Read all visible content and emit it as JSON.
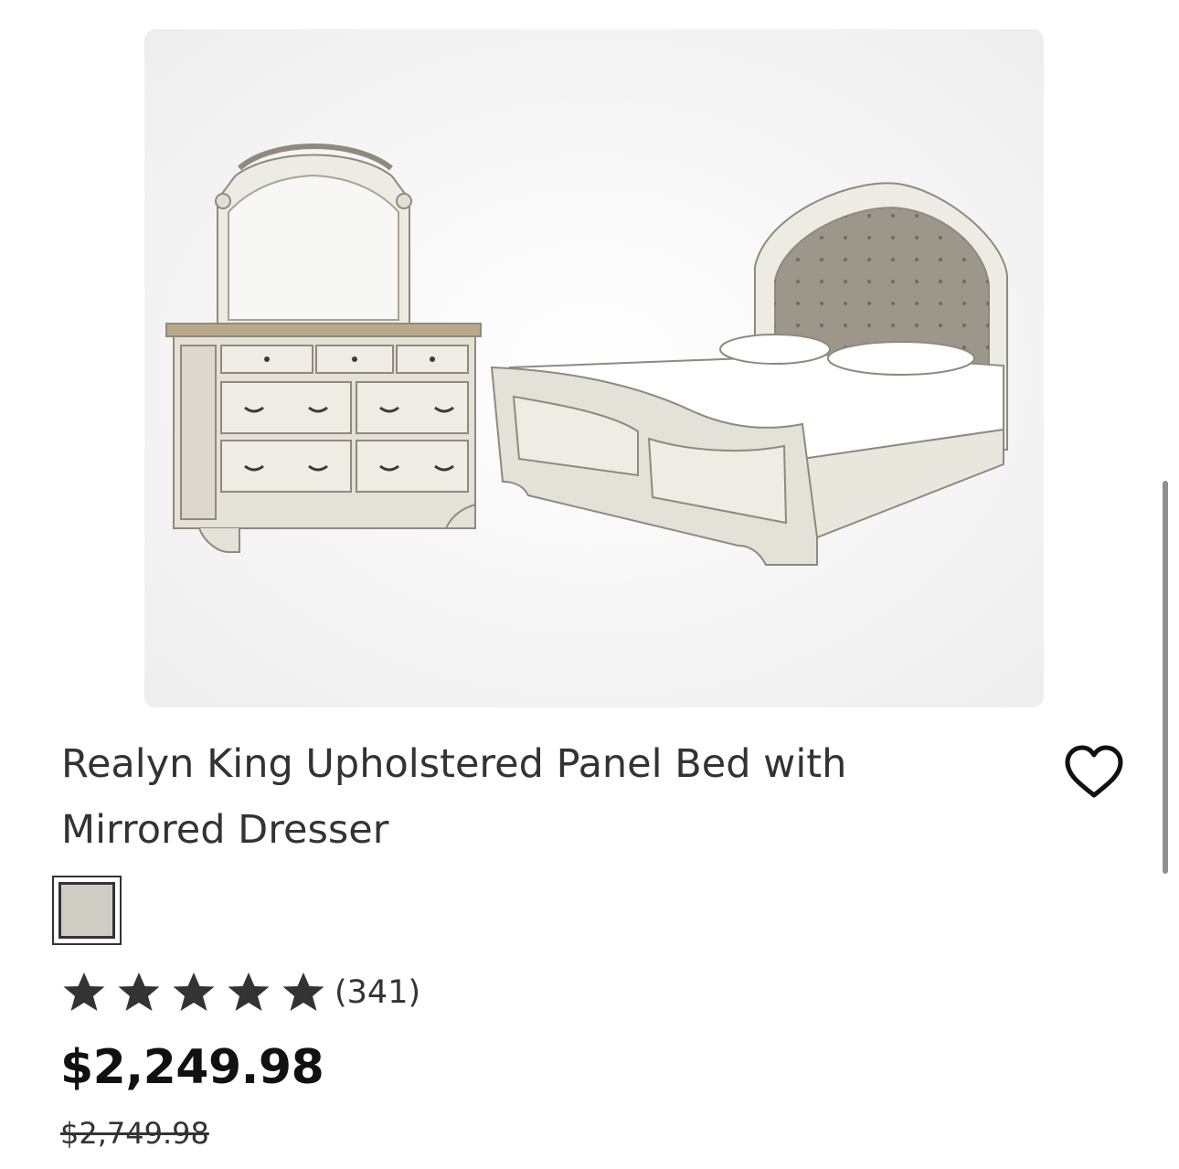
{
  "product": {
    "image_alt": "Bed and mirrored dresser set",
    "title": "Realyn King Upholstered Panel Bed with Mirrored Dresser",
    "swatch_color": "#cfccc4",
    "rating": {
      "stars": 5,
      "max_stars": 5,
      "count_label": "(341)"
    },
    "price": "$2,249.98",
    "original_price": "$2,749.98"
  },
  "colors": {
    "text": "#333333",
    "image_bg": "#f1f1f1"
  },
  "icons": {
    "favorite": "heart-outline-icon",
    "star": "star-filled-icon"
  }
}
